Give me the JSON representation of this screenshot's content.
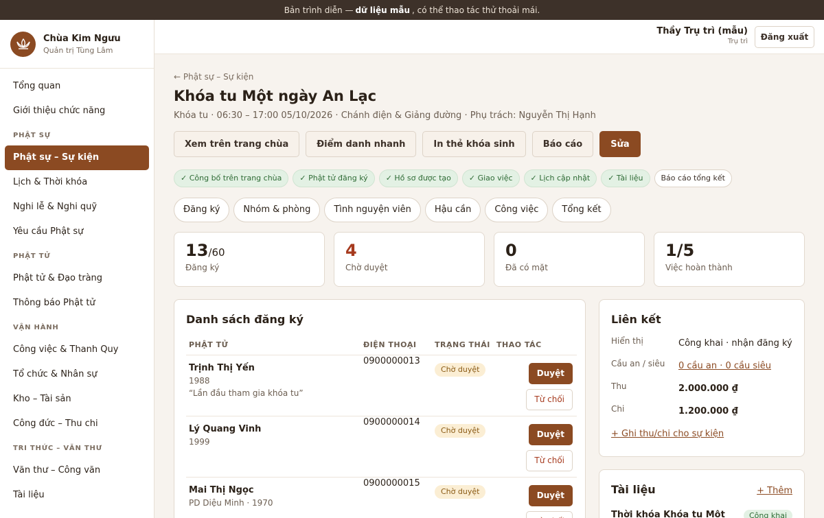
{
  "banner": {
    "prefix": "Bản trình diễn —",
    "bold": "dữ liệu mẫu",
    "suffix": ", có thể thao tác thử thoải mái."
  },
  "brand": {
    "name": "Chùa Kim Ngưu",
    "subtitle": "Quản trị Tùng Lâm"
  },
  "nav": {
    "overview": "Tổng quan",
    "features": "Giới thiệu chức năng",
    "section_phat_su": "PHẬT SỰ",
    "phat_su_su_kien": "Phật sự – Sự kiện",
    "lich": "Lịch & Thời khóa",
    "nghi_le": "Nghi lễ & Nghi quỹ",
    "yeu_cau": "Yêu cầu Phật sự",
    "section_phat_tu": "PHẬT TỬ",
    "dao_trang": "Phật tử & Đạo tràng",
    "thong_bao": "Thông báo Phật tử",
    "section_van_hanh": "VẬN HÀNH",
    "cong_viec": "Công việc & Thanh Quy",
    "to_chuc": "Tổ chức & Nhân sự",
    "kho": "Kho – Tài sản",
    "cong_duc": "Công đức – Thu chi",
    "section_tri_thuc": "TRI THỨC – VĂN THƯ",
    "van_thu": "Văn thư – Công văn",
    "tai_lieu": "Tài liệu"
  },
  "header": {
    "user_name": "Thầy Trụ trì (mẫu)",
    "user_role": "Trụ trì",
    "logout": "Đăng xuất"
  },
  "event": {
    "back": "← Phật sự – Sự kiện",
    "title": "Khóa tu Một ngày An Lạc",
    "meta": "Khóa tu · 06:30 – 17:00 05/10/2026 · Chánh điện & Giảng đường · Phụ trách: Nguyễn Thị Hạnh",
    "actions": [
      "Xem trên trang chùa",
      "Điểm danh nhanh",
      "In thẻ khóa sinh",
      "Báo cáo",
      "Sửa"
    ]
  },
  "checklist": [
    "✓ Công bố trên trang chùa",
    "✓ Phật tử đăng ký",
    "✓ Hồ sơ được tạo",
    "✓ Giao việc",
    "✓ Lịch cập nhật",
    "✓ Tài liệu",
    "Báo cáo tổng kết"
  ],
  "tabs": [
    "Đăng ký",
    "Nhóm & phòng",
    "Tình nguyện viên",
    "Hậu cần",
    "Công việc",
    "Tổng kết"
  ],
  "stats": [
    {
      "value": "13",
      "suffix": "/60",
      "label": "Đăng ký"
    },
    {
      "value": "4",
      "label": "Chờ duyệt"
    },
    {
      "value": "0",
      "label": "Đã có mặt"
    },
    {
      "value": "1/5",
      "label": "Việc hoàn thành"
    }
  ],
  "registrations": {
    "title": "Danh sách đăng ký",
    "headers": [
      "PHẬT TỬ",
      "ĐIỆN THOẠI",
      "TRẠNG THÁI",
      "THAO TÁC"
    ],
    "approve_label": "Duyệt",
    "reject_label": "Từ chối",
    "rows": [
      {
        "name": "Trịnh Thị Yến",
        "line1": "1988",
        "line2": "“Lần đầu tham gia khóa tu”",
        "phone": "0900000013",
        "status": "Chờ duyệt"
      },
      {
        "name": "Lý Quang Vinh",
        "line1": "1999",
        "phone": "0900000014",
        "status": "Chờ duyệt"
      },
      {
        "name": "Mai Thị Ngọc",
        "line1": "PD Diệu Minh · 1970",
        "phone": "0900000015",
        "status": "Chờ duyệt"
      }
    ]
  },
  "links": {
    "title": "Liên kết",
    "display_label": "Hiển thị",
    "display_value": "Công khai · nhận đăng ký",
    "prayer_label": "Cầu an / siêu",
    "prayer_value": "0 cầu an · 0 cầu siêu",
    "income_label": "Thu",
    "income_value": "2.000.000 ₫",
    "expense_label": "Chi",
    "expense_value": "1.200.000 ₫",
    "add_link": "+ Ghi thu/chi cho sự kiện"
  },
  "docs": {
    "title": "Tài liệu",
    "add": "+ Thêm",
    "first_doc": "Thời khóa Khóa tu Một",
    "first_badge": "Công khai"
  }
}
